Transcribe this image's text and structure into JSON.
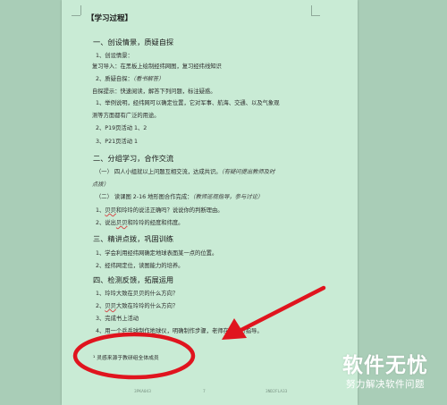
{
  "document": {
    "heading": "【学习过程】",
    "section1_title": "一、创设情景，质疑自探",
    "s1_item1": "1、创设情景：",
    "s1_review": "复习导入：在黑板上绘制经纬网图，复习经纬线知识",
    "s1_item2_prefix": "2、质疑自探：",
    "s1_item2_note": "（看书解答）",
    "s1_hint": "自探提示：快速阅读，解答下列问题，标注疑惑。",
    "s1_q1": "1、举例说明，经纬网可以确定位置，它对军事、航海、交通、以及气象观",
    "s1_q1_cont": "测等方面都有广泛的用途。",
    "s1_q2": "2、P19页活动 1、2",
    "s1_q3": "3、P21页活动 1",
    "section2_title": "二、分组学习，合作交流",
    "s2_item1": "（一）  四人小组就以上问题互相交流，达成共识。",
    "s2_item1_note": "（有疑问提出教师及时",
    "s2_item1_note_cont": "点拨）",
    "s2_item2": "（二）  读课图 2-16 地形图合作完成：",
    "s2_item2_note": "（教师巡视指导，参与讨论）",
    "s2_q1_num": "1、",
    "s2_q1_ul": "贝贝",
    "s2_q1_rest": "和玲玲的说法正确吗？说说你的判断理由。",
    "s2_q2_num": "2、说出",
    "s2_q2_ul": "贝贝",
    "s2_q2_rest": "和玲玲的经度和纬度。",
    "section3_title": "三、精讲点拨，巩固训练",
    "s3_q1": "1、学会利用经纬网确定地球表面某一点的位置。",
    "s3_q2": "2、经纬网定位，读图能力的培养。",
    "section4_title": "四、检测反馈，拓展运用",
    "s4_q1": "1、玲玲大致在贝贝的什么方向？",
    "s4_q2_num": "2、",
    "s4_q2_ul": "贝贝",
    "s4_q2_rest": "大致在玲玲的什么方向？",
    "s4_q3": "3、完成书上活动",
    "s4_q4": "4、用一个乒乓球制作地球仪，明确制作步骤，老师在边进行指导。",
    "footnote": "¹ 灵感来源于教研组全体成员",
    "footer_left": "3PKA043",
    "footer_center": "7",
    "footer_right": "3ND2FLA33"
  },
  "watermark": {
    "title": "软件无忧",
    "subtitle": "努力解决软件问题"
  },
  "annotation": {
    "color": "#e0141e"
  }
}
